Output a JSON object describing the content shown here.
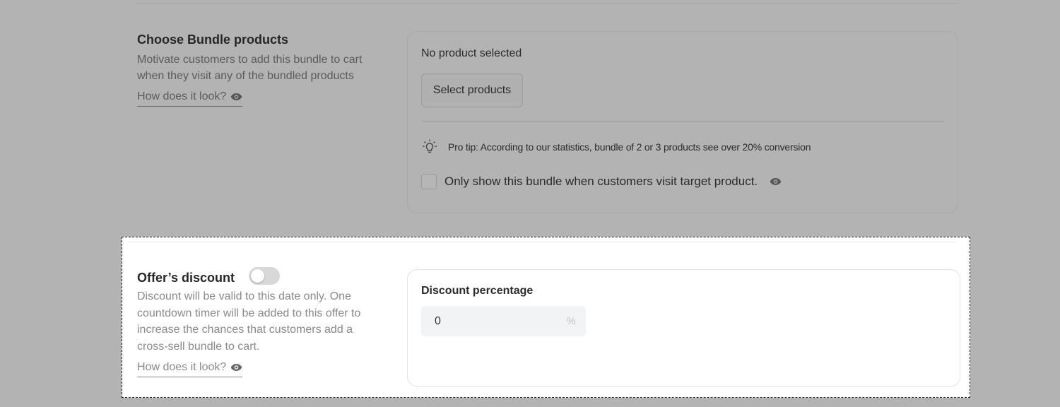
{
  "bundle": {
    "title": "Choose Bundle products",
    "description": "Motivate customers to add this bundle to cart when they visit any of the bundled products",
    "how_link": "How does it look?",
    "no_product": "No product selected",
    "select_button": "Select products",
    "tip": "Pro tip: According to our statistics, bundle of 2 or 3 products see over 20% conversion",
    "checkbox_label": "Only show this bundle when customers visit target product.",
    "checkbox_checked": false
  },
  "discount": {
    "title": "Offer’s discount",
    "toggle_on": false,
    "description": "Discount will be valid to this date only. One countdown timer will be added to this offer to increase the chances that customers add a cross-sell bundle to cart.",
    "how_link": "How does it look?",
    "field_label": "Discount percentage",
    "value": "0",
    "suffix": "%"
  },
  "icons": {
    "eye": "eye-icon",
    "bulb": "lightbulb-icon"
  },
  "colors": {
    "overlay_background": "#b3b3b3",
    "highlight_background": "#ffffff",
    "toggle_off": "#d8d8d8"
  }
}
